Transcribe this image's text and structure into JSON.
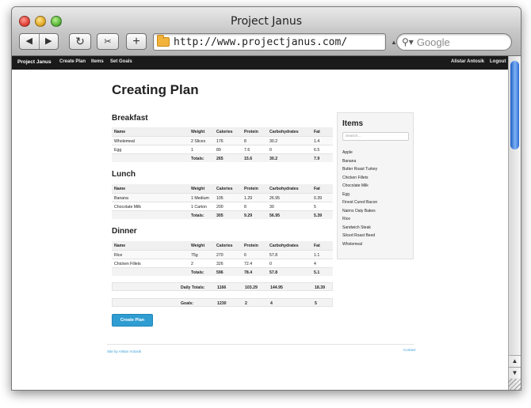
{
  "window": {
    "title": "Project Janus"
  },
  "browser": {
    "back_icon": "◀",
    "forward_icon": "▶",
    "reload_icon": "↻",
    "snap_icon": "✂",
    "add_icon": "+",
    "url": "http://www.projectjanus.com/",
    "search_placeholder": "Google"
  },
  "navbar": {
    "brand": "Project Janus",
    "links": [
      "Create Plan",
      "Items",
      "Set Goals"
    ],
    "user": "Alistar Antosik",
    "logout": "Logout"
  },
  "page": {
    "title": "Creating Plan"
  },
  "columns": [
    "Name",
    "Weight",
    "Calories",
    "Protein",
    "Carbohydrates",
    "Fat"
  ],
  "meals": [
    {
      "title": "Breakfast",
      "rows": [
        [
          "Wholemeal",
          "2 Slices",
          "176",
          "8",
          "30.2",
          "1.4"
        ],
        [
          "Egg",
          "1",
          "89",
          "7.6",
          "0",
          "6.5"
        ]
      ],
      "totals": [
        "Totals:",
        "265",
        "15.6",
        "30.2",
        "7.9"
      ]
    },
    {
      "title": "Lunch",
      "rows": [
        [
          "Banana",
          "1 Medium",
          "105",
          "1.29",
          "26.95",
          "0.39"
        ],
        [
          "Chocolate Milk",
          "1 Carton",
          "200",
          "8",
          "30",
          "5"
        ]
      ],
      "totals": [
        "Totals:",
        "305",
        "9.29",
        "56.95",
        "5.39"
      ]
    },
    {
      "title": "Dinner",
      "rows": [
        [
          "Rice",
          "75g",
          "270",
          "6",
          "57.8",
          "1.1"
        ],
        [
          "Chicken Fillets",
          "2",
          "326",
          "72.4",
          "0",
          "4"
        ]
      ],
      "totals": [
        "Totals:",
        "596",
        "78.4",
        "57.8",
        "5.1"
      ]
    }
  ],
  "daily_totals": [
    "Daily Totals:",
    "1166",
    "103.29",
    "144.95",
    "18.39"
  ],
  "goals": [
    "Goals:",
    "1230",
    "2",
    "4",
    "5"
  ],
  "create_button": "Create Plan",
  "items_panel": {
    "title": "Items",
    "search_placeholder": "Search...",
    "items": [
      "Apple",
      "Banana",
      "Butter Roast Turkey",
      "Chicken Fillets",
      "Chocolate Milk",
      "Egg",
      "Finest Cured Bacon",
      "Nairns Oaty Bakes",
      "Rice",
      "Sandwich Steak",
      "Sliced Roast Beed",
      "Wholemeal"
    ]
  },
  "footer": {
    "left": "Site by Alistar Antosik",
    "right": "Contact"
  },
  "colors": {
    "navbar": "#1a1a1a",
    "button": "#2f9dd1",
    "link": "#3aa0d8",
    "panel": "#f5f5f5"
  }
}
